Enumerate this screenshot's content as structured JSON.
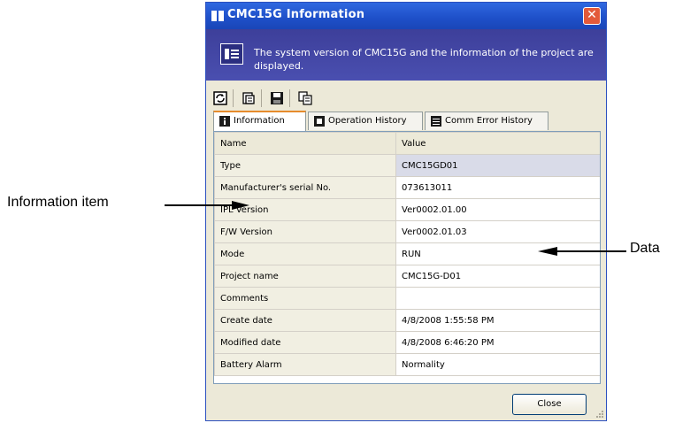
{
  "window": {
    "title": "CMC15G Information",
    "close_glyph": "✕",
    "banner_text": "The system version of CMC15G and the information of the project are displayed."
  },
  "toolbar": {
    "buttons": [
      {
        "icon": "refresh-icon"
      },
      {
        "icon": "print-preview-icon"
      },
      {
        "icon": "save-icon"
      },
      {
        "icon": "copy-icon"
      }
    ]
  },
  "tabs": [
    {
      "label": "Information",
      "icon": "info-icon",
      "active": true
    },
    {
      "label": "Operation History",
      "icon": "operation-history-icon",
      "active": false
    },
    {
      "label": "Comm Error History",
      "icon": "comm-error-icon",
      "active": false
    }
  ],
  "table": {
    "headers": [
      "Name",
      "Value"
    ],
    "rows": [
      {
        "name": "Type",
        "value": "CMC15GD01"
      },
      {
        "name": "Manufacturer's serial No.",
        "value": "073613011"
      },
      {
        "name": "IPL Version",
        "value": "Ver0002.01.00"
      },
      {
        "name": "F/W Version",
        "value": "Ver0002.01.03"
      },
      {
        "name": "Mode",
        "value": "RUN"
      },
      {
        "name": "Project name",
        "value": "CMC15G-D01"
      },
      {
        "name": "Comments",
        "value": ""
      },
      {
        "name": "Create date",
        "value": "4/8/2008 1:55:58 PM"
      },
      {
        "name": "Modified date",
        "value": "4/8/2008 6:46:20 PM"
      },
      {
        "name": "Battery Alarm",
        "value": "Normality"
      }
    ]
  },
  "footer": {
    "close_label": "Close"
  },
  "callouts": {
    "left": "Information item",
    "right": "Data"
  },
  "colors": {
    "titlebar": "#1e4fc8",
    "banner": "#4a4fb0",
    "active_tab_accent": "#e68b2c",
    "selected_row": "#d9dbe8"
  }
}
